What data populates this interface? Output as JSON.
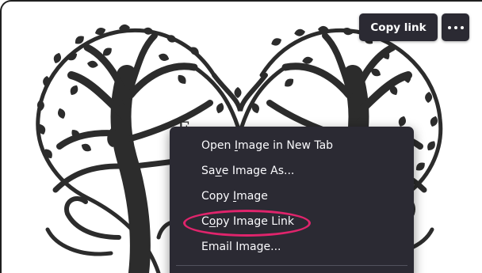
{
  "toolbar": {
    "copy_link_label": "Copy link",
    "more_icon": "more-horizontal-icon"
  },
  "image": {
    "subject": "heart-shaped-tree-of-life-illustration"
  },
  "context_menu": {
    "items": [
      {
        "before": "Open ",
        "accel": "I",
        "after": "mage in New Tab"
      },
      {
        "before": "Sa",
        "accel": "v",
        "after": "e Image As..."
      },
      {
        "before": "Copy ",
        "accel": "I",
        "after": "mage"
      },
      {
        "before": "C",
        "accel": "o",
        "after": "py Image Link"
      },
      {
        "before": "Email Image...",
        "accel": "",
        "after": ""
      }
    ]
  },
  "colors": {
    "menu_bg": "#2b2a33",
    "menu_text": "#fbfbfe",
    "highlight": "#e0246c",
    "tree": "#2c2c2c"
  }
}
